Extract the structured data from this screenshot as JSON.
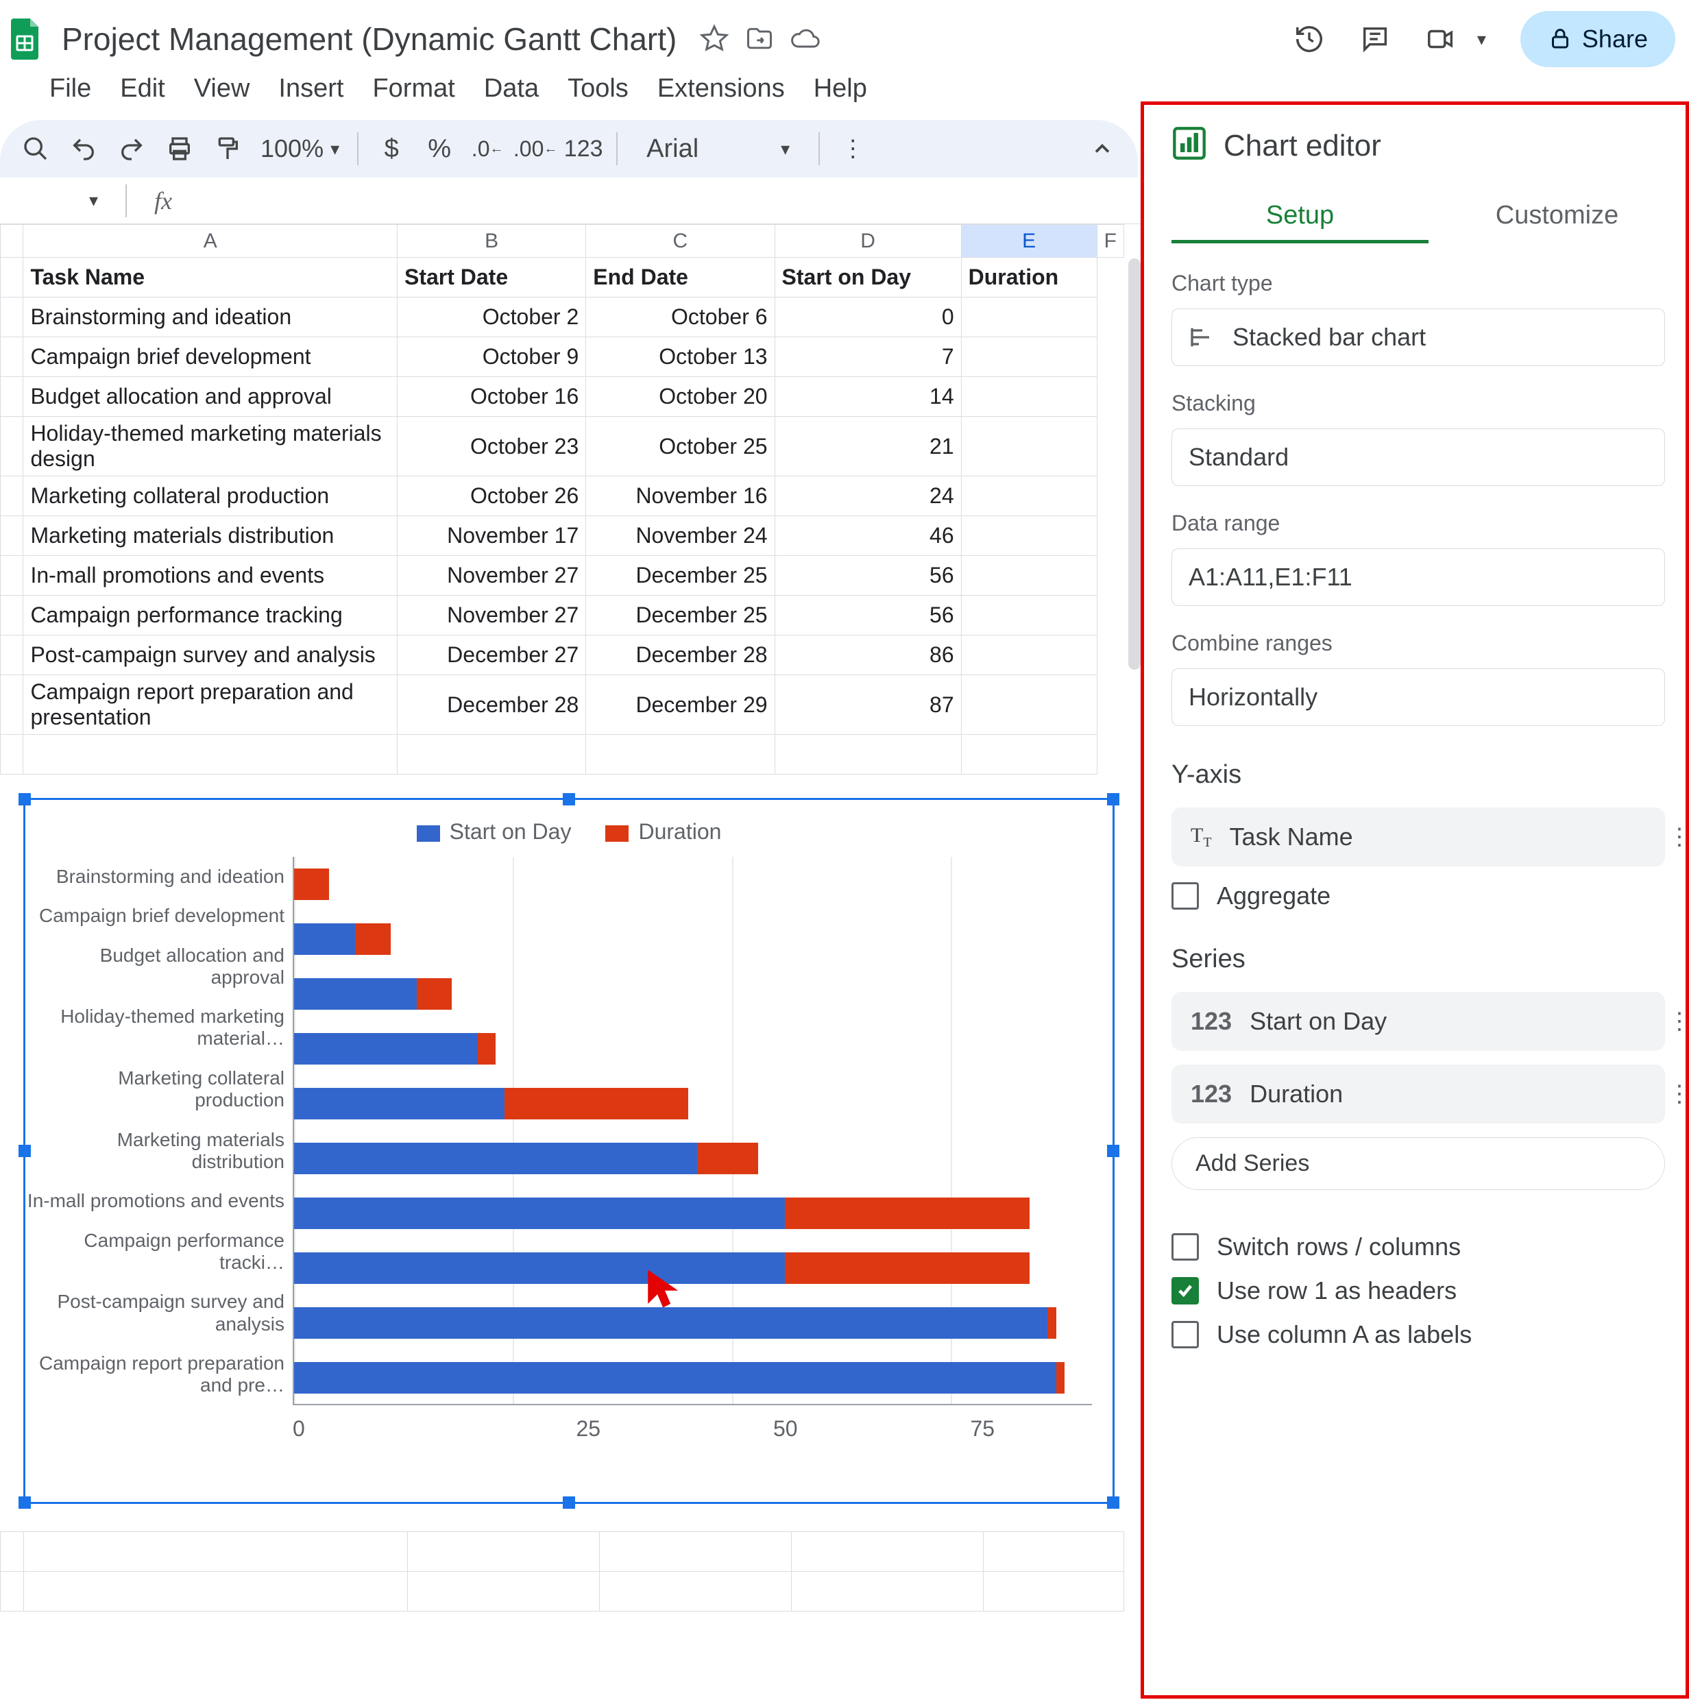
{
  "doc": {
    "title": "Project Management (Dynamic Gantt Chart)"
  },
  "menus": {
    "file": "File",
    "edit": "Edit",
    "view": "View",
    "insert": "Insert",
    "format": "Format",
    "data": "Data",
    "tools": "Tools",
    "extensions": "Extensions",
    "help": "Help"
  },
  "toolbar": {
    "zoom": "100%",
    "font": "Arial",
    "btn_123": "123",
    "dollar": "$",
    "percent": "%"
  },
  "share_label": "Share",
  "columns": {
    "A": "A",
    "B": "B",
    "C": "C",
    "D": "D",
    "E": "E",
    "F": "F"
  },
  "headers": {
    "task": "Task Name",
    "start_date": "Start Date",
    "end_date": "End Date",
    "start_on_day": "Start on Day",
    "duration": "Duration"
  },
  "rows": [
    {
      "task": "Brainstorming and ideation",
      "start": "October 2",
      "end": "October 6",
      "day": "0"
    },
    {
      "task": "Campaign brief development",
      "start": "October 9",
      "end": "October 13",
      "day": "7"
    },
    {
      "task": "Budget allocation and approval",
      "start": "October 16",
      "end": "October 20",
      "day": "14"
    },
    {
      "task": "Holiday-themed marketing materials design",
      "start": "October 23",
      "end": "October 25",
      "day": "21"
    },
    {
      "task": "Marketing collateral production",
      "start": "October 26",
      "end": "November 16",
      "day": "24"
    },
    {
      "task": "Marketing materials distribution",
      "start": "November 17",
      "end": "November 24",
      "day": "46"
    },
    {
      "task": "In-mall promotions and events",
      "start": "November 27",
      "end": "December 25",
      "day": "56"
    },
    {
      "task": "Campaign performance tracking",
      "start": "November 27",
      "end": "December 25",
      "day": "56"
    },
    {
      "task": "Post-campaign survey and analysis",
      "start": "December 27",
      "end": "December 28",
      "day": "86"
    },
    {
      "task": "Campaign report preparation and presentation",
      "start": "December 28",
      "end": "December 29",
      "day": "87"
    }
  ],
  "chart_data": {
    "type": "bar",
    "orientation": "horizontal",
    "stacked": true,
    "legend": [
      "Start on Day",
      "Duration"
    ],
    "categories": [
      "Brainstorming and ideation",
      "Campaign brief development",
      "Budget allocation and approval",
      "Holiday-themed marketing material…",
      "Marketing collateral production",
      "Marketing materials distribution",
      "In-mall promotions and events",
      "Campaign performance tracki…",
      "Post-campaign survey and analysis",
      "Campaign report preparation and pre…"
    ],
    "series": [
      {
        "name": "Start on Day",
        "color": "#3366cc",
        "values": [
          0,
          7,
          14,
          21,
          24,
          46,
          56,
          56,
          86,
          87
        ]
      },
      {
        "name": "Duration",
        "color": "#dc3912",
        "values": [
          4,
          4,
          4,
          2,
          21,
          7,
          28,
          28,
          1,
          1
        ]
      }
    ],
    "xticks": [
      0,
      25,
      50,
      75
    ],
    "xmax": 90
  },
  "editor": {
    "title": "Chart editor",
    "tab_setup": "Setup",
    "tab_customize": "Customize",
    "chart_type_label": "Chart type",
    "chart_type_value": "Stacked bar chart",
    "stacking_label": "Stacking",
    "stacking_value": "Standard",
    "data_range_label": "Data range",
    "data_range_value": "A1:A11,E1:F11",
    "combine_label": "Combine ranges",
    "combine_value": "Horizontally",
    "yaxis_label": "Y-axis",
    "yaxis_value": "Task Name",
    "aggregate": "Aggregate",
    "series_label": "Series",
    "series_1": "Start on Day",
    "series_2": "Duration",
    "add_series": "Add Series",
    "switch_rows": "Switch rows / columns",
    "use_row1": "Use row 1 as headers",
    "use_colA": "Use column A as labels",
    "numeric_prefix": "123"
  }
}
